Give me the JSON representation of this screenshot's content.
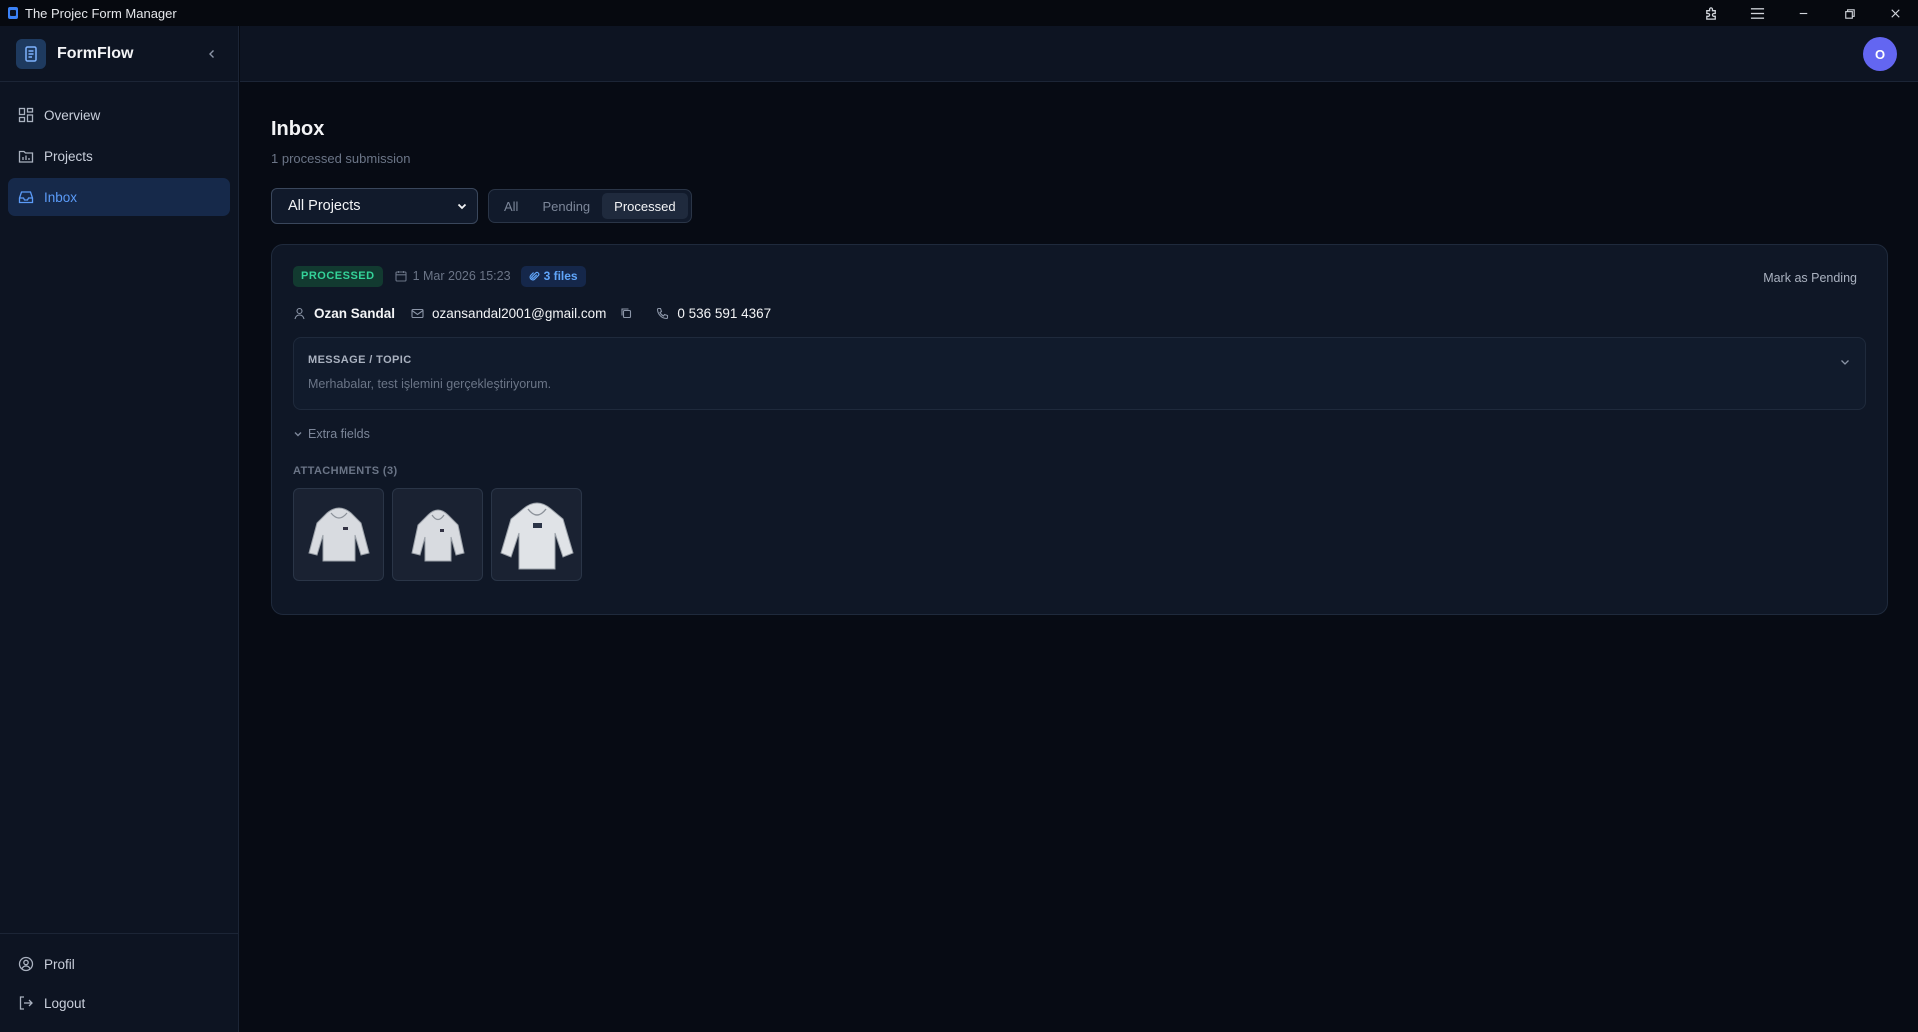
{
  "window": {
    "title": "The Projec Form Manager"
  },
  "sidebar": {
    "brand": "FormFlow",
    "items": [
      {
        "label": "Overview",
        "icon": "grid-icon"
      },
      {
        "label": "Projects",
        "icon": "chart-folder-icon"
      },
      {
        "label": "Inbox",
        "icon": "inbox-icon",
        "active": true
      }
    ],
    "bottom": [
      {
        "label": "Profil",
        "icon": "user-circle-icon"
      },
      {
        "label": "Logout",
        "icon": "logout-icon"
      }
    ]
  },
  "topbar": {
    "avatar_initial": "O"
  },
  "page": {
    "title": "Inbox",
    "subtitle": "1 processed submission"
  },
  "filters": {
    "project_select": "All Projects",
    "segments": [
      "All",
      "Pending",
      "Processed"
    ],
    "active_segment": "Processed"
  },
  "submission": {
    "status": "PROCESSED",
    "date": "1 Mar 2026 15:23",
    "files": "3 files",
    "action": "Mark as Pending",
    "name": "Ozan Sandal",
    "email": "ozansandal2001@gmail.com",
    "phone": "0 536 591 4367",
    "message_label": "MESSAGE / TOPIC",
    "message_text": "Merhabalar, test işlemini gerçekleştiriyorum.",
    "extra_fields": "Extra fields",
    "attachments_label": "ATTACHMENTS (3)"
  },
  "colors": {
    "background": "#070b14",
    "sidebar": "#0d1422",
    "accent": "#5b9bf8",
    "status_green": "#34d399",
    "avatar": "#6366f1"
  }
}
